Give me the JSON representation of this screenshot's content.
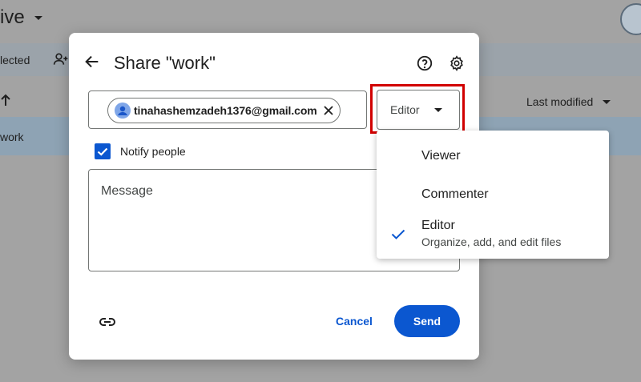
{
  "background": {
    "title": "ive",
    "toolbar_selected": "lected",
    "column_last_modified": "Last modified",
    "row_name": "work"
  },
  "dialog": {
    "title": "Share \"work\"",
    "recipient_email": "tinahashemzadeh1376@gmail.com",
    "role": "Editor",
    "notify_label": "Notify people",
    "notify_checked": true,
    "message_placeholder": "Message",
    "cancel_label": "Cancel",
    "send_label": "Send"
  },
  "role_menu": {
    "items": [
      {
        "label": "Viewer",
        "description": "",
        "selected": false
      },
      {
        "label": "Commenter",
        "description": "",
        "selected": false
      },
      {
        "label": "Editor",
        "description": "Organize, add, and edit files",
        "selected": true
      }
    ]
  },
  "colors": {
    "accent": "#0b57d0",
    "highlight": "#d10000"
  },
  "icons": {
    "back": "arrow-left-icon",
    "help": "help-circle-icon",
    "settings": "gear-icon",
    "chip_avatar": "person-avatar-icon",
    "chip_remove": "close-icon",
    "link": "link-icon",
    "check": "check-icon"
  }
}
